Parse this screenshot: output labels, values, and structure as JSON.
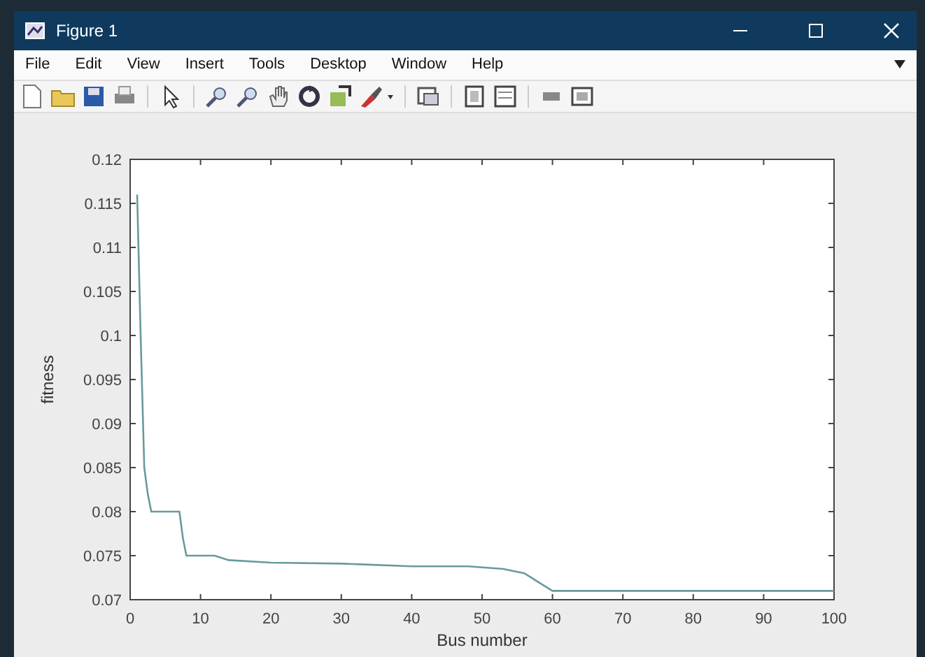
{
  "window": {
    "title": "Figure 1"
  },
  "menu": [
    "File",
    "Edit",
    "View",
    "Insert",
    "Tools",
    "Desktop",
    "Window",
    "Help"
  ],
  "toolbar": [
    {
      "kind": "new"
    },
    {
      "kind": "open"
    },
    {
      "kind": "save"
    },
    {
      "kind": "print"
    },
    {
      "kind": "sep"
    },
    {
      "kind": "pointer"
    },
    {
      "kind": "sep"
    },
    {
      "kind": "zoomin"
    },
    {
      "kind": "zoomout"
    },
    {
      "kind": "pan"
    },
    {
      "kind": "rotate"
    },
    {
      "kind": "cursor"
    },
    {
      "kind": "brush"
    },
    {
      "kind": "sep"
    },
    {
      "kind": "link"
    },
    {
      "kind": "sep"
    },
    {
      "kind": "colorbar"
    },
    {
      "kind": "legend"
    },
    {
      "kind": "sep"
    },
    {
      "kind": "hide"
    },
    {
      "kind": "show"
    }
  ],
  "figure": {
    "chart_data": {
      "type": "line",
      "xlabel": "Bus number",
      "ylabel": "fitness",
      "xlim": [
        0,
        100
      ],
      "ylim": [
        0.07,
        0.12
      ],
      "xticks": [
        0,
        10,
        20,
        30,
        40,
        50,
        60,
        70,
        80,
        90,
        100
      ],
      "yticks": [
        0.07,
        0.075,
        0.08,
        0.085,
        0.09,
        0.095,
        0.1,
        0.105,
        0.11,
        0.115,
        0.12
      ],
      "x": [
        1,
        1.5,
        2,
        2.5,
        3,
        7,
        7.5,
        8,
        12,
        14,
        20,
        30,
        40,
        48,
        53,
        56,
        58,
        60,
        100
      ],
      "series": [
        {
          "color": "#6a9a9a",
          "values": [
            0.116,
            0.1,
            0.085,
            0.082,
            0.08,
            0.08,
            0.077,
            0.075,
            0.075,
            0.0745,
            0.0742,
            0.0741,
            0.0738,
            0.0738,
            0.0735,
            0.073,
            0.072,
            0.071,
            0.071
          ]
        }
      ]
    }
  }
}
